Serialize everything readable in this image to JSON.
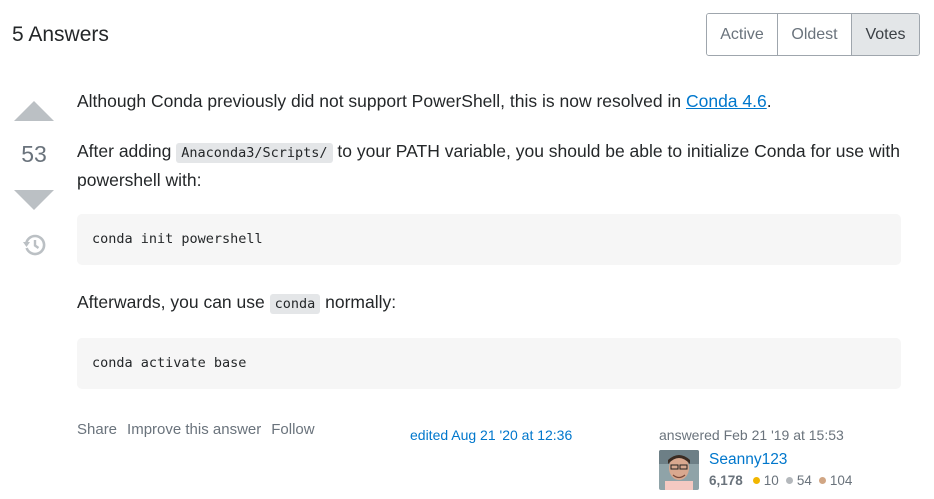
{
  "header": {
    "answers_title": "5 Answers"
  },
  "sort_tabs": [
    {
      "label": "Active",
      "selected": false
    },
    {
      "label": "Oldest",
      "selected": false
    },
    {
      "label": "Votes",
      "selected": true
    }
  ],
  "votes": {
    "count": "53"
  },
  "answer": {
    "p1_text": "Although Conda previously did not support PowerShell, this is now resolved in ",
    "p1_link": "Conda 4.6",
    "p1_end": ".",
    "p2_start": "After adding ",
    "p2_code": "Anaconda3/Scripts/",
    "p2_end": " to your PATH variable, you should be able to initialize Conda for use with powershell with:",
    "code1": "conda init powershell",
    "p3_start": "Afterwards, you can use ",
    "p3_code": "conda",
    "p3_end": " normally:",
    "code2": "conda activate base"
  },
  "post_menu": {
    "share": "Share",
    "improve": "Improve this answer",
    "follow": "Follow"
  },
  "edit_info": {
    "text": "edited Aug 21 '20 at 12:36"
  },
  "user": {
    "answered_text": "answered Feb 21 '19 at 15:53",
    "name": "Seanny123",
    "reputation": "6,178",
    "gold": "10",
    "silver": "54",
    "bronze": "104"
  },
  "colors": {
    "link": "#0077cc",
    "vote_arrow": "#bbc0c4",
    "code_bg": "#f6f6f6"
  },
  "icons": {
    "vote_up": "triangle-up",
    "vote_down": "triangle-down",
    "history": "history-clock"
  }
}
